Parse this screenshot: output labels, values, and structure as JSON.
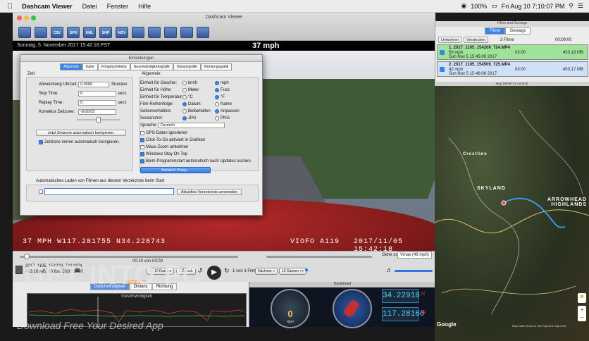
{
  "menubar": {
    "apple": "",
    "app": "Dashcam Viewer",
    "items": [
      "Datei",
      "Fenster",
      "Hilfe"
    ],
    "battery": "100%",
    "clock": "Fri Aug 10  7:10:07 PM"
  },
  "window": {
    "title": "Dashcam Viewer",
    "toolbar": [
      "",
      "",
      "CSV",
      "GPX",
      "KML",
      "SHP",
      "NOV",
      "",
      "",
      "",
      "",
      ""
    ]
  },
  "infobar": {
    "timestamp": "Sonntag, 5. November 2017 15:42:18 PST",
    "speed": "37 mph"
  },
  "osd": {
    "left": "37 MPH W117.281755 N34.228743",
    "center": "VIOFO A119",
    "right": "2017/11/05 15:42:18"
  },
  "transport": {
    "position": "00:10 von 03:00",
    "file_name": "2017_1105_154209_724.MP4",
    "file_meta": "453.18 MB, 60 fps, 1920x1080",
    "back10": "<< 10 Dateien",
    "back": "< Zurück",
    "file_of": "1 von 3 Filmen",
    "next": "Nächster >",
    "forward10": "10 Dateien >>",
    "goto_label": "Gehe zu:",
    "goto_value": "Vmax (49 mph)"
  },
  "graph": {
    "tabs": [
      "Geschwindigkeit",
      "Distanz",
      "Richtung"
    ],
    "top_tab": "Diagramm",
    "title": "Geschwindigkeit",
    "date": "Sonntag, 5. November 2017 15:42:18 PST"
  },
  "dashboard": {
    "title": "Dashboard",
    "speed_value": "0",
    "speed_unit": "mph",
    "lat": "34.22918",
    "lat_dir": "N",
    "lon": "117.28160",
    "lon_dir": "W"
  },
  "filelist": {
    "title": "Filme und Geotags",
    "segments": [
      "Filme",
      "Geotags"
    ],
    "btn_reset": "Umkehren",
    "btn_hide": "Verstecken",
    "count": "3 Filme",
    "total": "00:09:00",
    "files": [
      {
        "name": "1. 2017_1105_154209_724.MP4",
        "speed": "50 mph",
        "duration": "03:00",
        "date": "Sun Nov 5 15:45:09 2017",
        "size": "453.18 MB"
      },
      {
        "name": "2. 2017_1105_154509_725.MP4",
        "speed": "42 mph",
        "duration": "03:00",
        "date": "Sun Nov 5 15:48:08 2017",
        "size": "453.17 MB"
      }
    ]
  },
  "map": {
    "title": "Map (Wider for control)",
    "labels": [
      "Crestline",
      "SKYLAND",
      "ARROWHEAD HIGHLANDS"
    ],
    "google": "Google",
    "footer": "Map Data  Terms of Use  Report a map error"
  },
  "dialog": {
    "title": "Einstellungen",
    "tabs": [
      "Allgemein",
      "Karte",
      "Fortgeschrittens",
      "Geschwindigkeitsgrafik",
      "Distanzgrafik",
      "Richtungsgrafik"
    ],
    "left_group": "Zeit:",
    "offset_label": "Abweichung Uhrzeit:",
    "offset_value": "0.0000",
    "offset_unit": "Stunden",
    "skip_label": "Skip Time:",
    "skip_value": "0",
    "skip_unit": "secs",
    "replay_label": "Replay Time:",
    "replay_value": "5",
    "replay_unit": "secs",
    "tz_label": "Korrektur Zeitzone:",
    "tz_value": "-8:00:03",
    "tz_button": "Jetzt Zeitzone automatisch korrigieren.",
    "tz_check": "Zeitzone immer automatisch korrigieren.",
    "right_group": "Allgemein:",
    "speed_unit_label": "Einheit für Geschw:",
    "speed_opts": [
      "km/h",
      "mph"
    ],
    "height_label": "Einheit für Höhe:",
    "height_opts": [
      "Meter",
      "Fuss"
    ],
    "temp_label": "Einheit für Temperatur:",
    "temp_opts": [
      "°C",
      "°F"
    ],
    "order_label": "Film-Reihenfolge:",
    "order_opts": [
      "Datum",
      "Name"
    ],
    "aspect_label": "Seitenverhältnis:",
    "aspect_opts": [
      "Beibehalten",
      "Anpassen"
    ],
    "shot_label": "Screenshot:",
    "shot_opts": [
      "JPG",
      "PNG"
    ],
    "lang_label": "Sprache:",
    "lang_value": "Deutsch",
    "checks": [
      "GPS-Daten ignorieren",
      "Click-To-Go aktiviert in Grafiken",
      "Maus-Zoom umkehren",
      "Windows Stay On Top",
      "Beim Programmstart automatisch nach Updates suchen."
    ],
    "proxy_button": "Network Proxy...",
    "autoload_label": "Automatisches Laden von Filmen aus diesem Verzeichnis beim Start",
    "autoload_button": "Aktuelles Verzeichnis verwenden"
  },
  "watermark": {
    "big": "GET INTO PC",
    "sub": "Download Free Your Desired App"
  },
  "colors": {
    "accent": "#3a84e6",
    "file_row_1": "#9fe39a",
    "file_row_2": "#cfe0f7",
    "coord_text": "#4fd8ff"
  }
}
